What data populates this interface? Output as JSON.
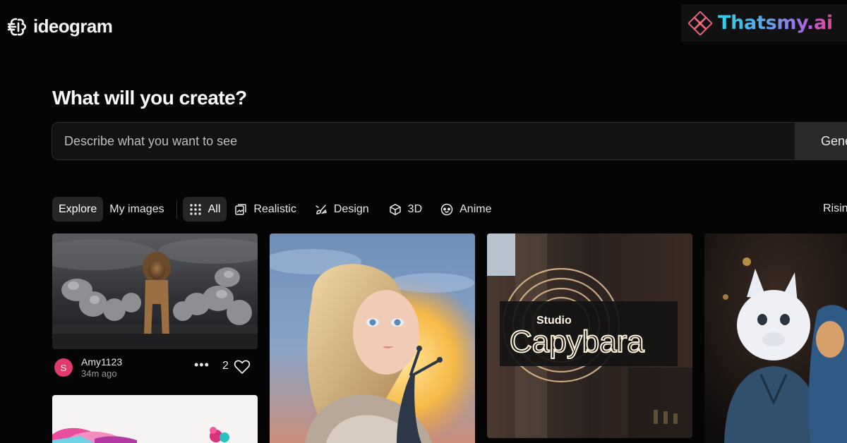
{
  "header": {
    "logo_text": "ideogram",
    "logo_icon": "ideogram-brain-icon",
    "watermark_text": "Thatsmy.ai",
    "watermark_icon": "diamond-flower-icon"
  },
  "main": {
    "heading": "What will you create?",
    "search": {
      "placeholder": "Describe what you want to see",
      "generate_label": "Gene"
    }
  },
  "filters": {
    "tabs": [
      {
        "label": "Explore",
        "active": true
      },
      {
        "label": "My images",
        "active": false
      }
    ],
    "categories": [
      {
        "label": "All",
        "icon": "grid-dots-icon",
        "active": true
      },
      {
        "label": "Realistic",
        "icon": "photo-stack-icon",
        "active": false
      },
      {
        "label": "Design",
        "icon": "design-brush-icon",
        "active": false
      },
      {
        "label": "3D",
        "icon": "cube-icon",
        "active": false
      },
      {
        "label": "Anime",
        "icon": "anime-face-icon",
        "active": false
      }
    ],
    "sort_label": "Risin"
  },
  "cards": [
    {
      "image": "lion among howling wolves",
      "user_initial": "S",
      "username": "Amy1123",
      "time": "34m ago",
      "likes": "2",
      "more_icon": "more-dots-icon",
      "heart_icon": "heart-icon"
    },
    {
      "image": "girl portrait with snail"
    },
    {
      "image": "Studio Capybara neon sign",
      "sign_line1": "Studio",
      "sign_line2": "Capybara"
    },
    {
      "image": "3D cartoon cat characters"
    },
    {
      "image": "colorful heart pattern"
    }
  ]
}
